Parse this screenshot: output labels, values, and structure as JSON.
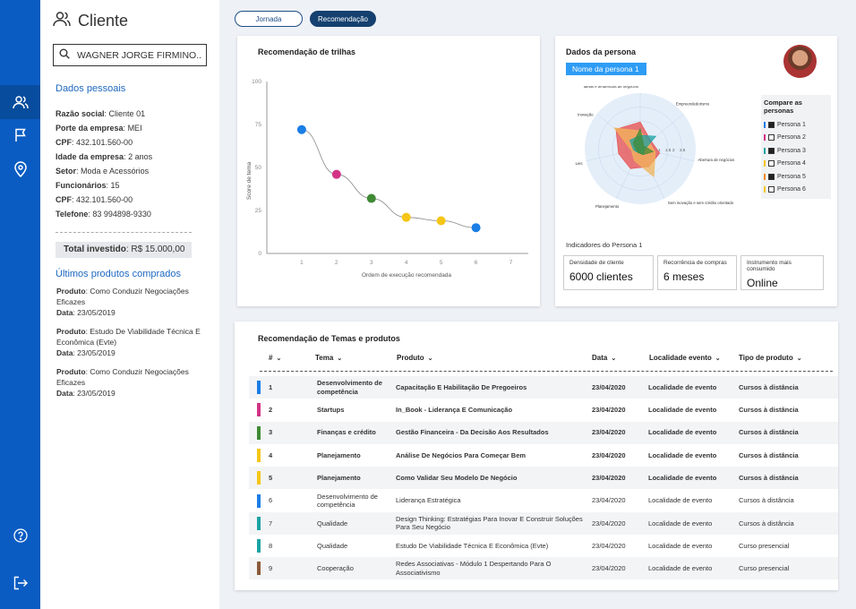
{
  "app": {
    "title": "Cliente"
  },
  "search": {
    "value": "WAGNER JORGE FIRMINO..."
  },
  "sidebar": {
    "section_title": "Dados pessoais"
  },
  "client_info": [
    {
      "label": "Razão social",
      "value": "Cliente 01"
    },
    {
      "label": "Porte da empresa",
      "value": "MEI"
    },
    {
      "label": "CPF",
      "value": "432.101.560-00"
    },
    {
      "label": "Idade da empresa",
      "value": "2 anos"
    },
    {
      "label": "Setor",
      "value": "Moda e Acessórios"
    },
    {
      "label": "Funcionários",
      "value": "15"
    },
    {
      "label": "CPF",
      "value": "432.101.560-00"
    },
    {
      "label": "Telefone",
      "value": "83 994898-9330"
    }
  ],
  "total": {
    "label": "Total investido",
    "value": "R$ 15.000,00"
  },
  "recent": {
    "title": "Últimos produtos comprados",
    "items": [
      {
        "produto_label": "Produto",
        "produto": "Como Conduzir Negociações Eficazes",
        "data_label": "Data",
        "data": "23/05/2019"
      },
      {
        "produto_label": "Produto",
        "produto": "Estudo De Viabilidade Técnica E Econômica (Evte)",
        "data_label": "Data",
        "data": "23/05/2019"
      },
      {
        "produto_label": "Produto",
        "produto": "Como Conduzir Negociações Eficazes",
        "data_label": "Data",
        "data": "23/05/2019"
      }
    ]
  },
  "tabs": [
    {
      "label": "Jornada"
    },
    {
      "label": "Recomendação"
    }
  ],
  "colors": {
    "rail": "#0a5cc2",
    "accent": "#1d68c1",
    "blue": "#1a7ee6",
    "magenta": "#d33486",
    "green": "#3f8a35",
    "yellow": "#f5c518",
    "teal": "#1ba3a3",
    "brown": "#8a5a3a",
    "orange": "#f28c28"
  },
  "chart_data": [
    {
      "type": "line",
      "title": "Recomendação de trilhas",
      "xlabel": "Ordem de execução recomendada",
      "ylabel": "Score de tema",
      "x": [
        1,
        2,
        3,
        4,
        5,
        6
      ],
      "y": [
        72,
        46,
        32,
        21,
        19,
        15
      ],
      "point_colors": [
        "#1a7ee6",
        "#d33486",
        "#3f8a35",
        "#f5c518",
        "#f5c518",
        "#1a7ee6"
      ],
      "xticks": [
        "1",
        "2",
        "3",
        "4",
        "5",
        "6",
        "7"
      ],
      "yticks": [
        "0",
        "25",
        "50",
        "75",
        "100"
      ],
      "xlim": [
        0,
        7.5
      ],
      "ylim": [
        0,
        100
      ]
    },
    {
      "type": "radar",
      "title": "Dados da persona",
      "axes": [
        "Ideias e tendências de negócios",
        "Empreendedorismo",
        "Abertura de negócios",
        "Sem inovação e sem crédito orientado",
        "Planejamento",
        "Leis",
        "Inovação"
      ],
      "ticks": [
        "1",
        "1.5",
        "2",
        "2.5"
      ],
      "series": [
        {
          "name": "Persona 1",
          "color": "#e84b4b",
          "values": [
            1.2,
            0.6,
            0.9,
            0.9,
            1.0,
            1.0,
            1.4
          ]
        },
        {
          "name": "Persona 4",
          "color": "#f2b45a",
          "values": [
            0.8,
            0.5,
            0.7,
            1.4,
            0.6,
            0.4,
            1.5
          ]
        },
        {
          "name": "Persona 3",
          "color": "#1ba3a3",
          "values": [
            0.6,
            0.9,
            0.2,
            0.3,
            0.2,
            0.3,
            0.6
          ]
        },
        {
          "name": "Persona 6",
          "color": "#3f8a35",
          "values": [
            0.9,
            0.2,
            0.6,
            0.3,
            0.2,
            0.2,
            0.4
          ]
        }
      ]
    }
  ],
  "persona": {
    "title": "Dados da persona",
    "name": "Nome da persona 1",
    "compare_title": "Compare as personas",
    "list": [
      {
        "label": "Persona 1",
        "color": "#1a7ee6",
        "checked": true
      },
      {
        "label": "Persona 2",
        "color": "#d33486",
        "checked": false
      },
      {
        "label": "Persona 3",
        "color": "#1ba3a3",
        "checked": true
      },
      {
        "label": "Persona 4",
        "color": "#f5c518",
        "checked": false
      },
      {
        "label": "Persona 5",
        "color": "#f28c28",
        "checked": true
      },
      {
        "label": "Persona 6",
        "color": "#f5c518",
        "checked": false
      }
    ],
    "indicators_title": "Indicadores do Persona 1",
    "indicators": [
      {
        "label": "Densidade de cliente",
        "value": "6000 clientes"
      },
      {
        "label": "Recorrência de compras",
        "value": "6 meses"
      },
      {
        "label": "Instrumento mais consumido",
        "value": "Online"
      }
    ]
  },
  "table": {
    "title": "Recomendação de Temas e produtos",
    "columns": [
      "#",
      "Tema",
      "Produto",
      "Data",
      "Localidade evento",
      "Tipo de produto"
    ],
    "rows": [
      {
        "n": "1",
        "tema": "Desenvolvimento de competência",
        "produto": "Capacitação E Habilitação De Pregoeiros",
        "data": "23/04/2020",
        "local": "Localidade de evento",
        "tipo": "Cursos à distância",
        "color": "#1a7ee6",
        "bold": true
      },
      {
        "n": "2",
        "tema": "Startups",
        "produto": "In_Book - Liderança E Comunicação",
        "data": "23/04/2020",
        "local": "Localidade de evento",
        "tipo": "Cursos à distância",
        "color": "#d33486",
        "bold": true
      },
      {
        "n": "3",
        "tema": "Finanças e crédito",
        "produto": "Gestão Financeira - Da Decisão Aos Resultados",
        "data": "23/04/2020",
        "local": "Localidade de evento",
        "tipo": "Cursos à distância",
        "color": "#3f8a35",
        "bold": true
      },
      {
        "n": "4",
        "tema": "Planejamento",
        "produto": "Análise De Negócios Para Começar Bem",
        "data": "23/04/2020",
        "local": "Localidade de evento",
        "tipo": "Cursos à distância",
        "color": "#f5c518",
        "bold": true
      },
      {
        "n": "5",
        "tema": "Planejamento",
        "produto": "Como Validar Seu Modelo De Negócio",
        "data": "23/04/2020",
        "local": "Localidade de evento",
        "tipo": "Cursos à distância",
        "color": "#f5c518",
        "bold": true
      },
      {
        "n": "6",
        "tema": "Desenvolvimento de competência",
        "produto": "Liderança Estratégica",
        "data": "23/04/2020",
        "local": "Localidade de evento",
        "tipo": "Cursos à distância",
        "color": "#1a7ee6",
        "bold": false
      },
      {
        "n": "7",
        "tema": "Qualidade",
        "produto": "Design Thinking: Estratégias Para Inovar E Construir Soluções Para Seu Negócio",
        "data": "23/04/2020",
        "local": "Localidade de evento",
        "tipo": "Cursos à distância",
        "color": "#1ba3a3",
        "bold": false
      },
      {
        "n": "8",
        "tema": "Qualidade",
        "produto": "Estudo De Viabilidade Técnica E Econômica (Evte)",
        "data": "23/04/2020",
        "local": "Localidade de evento",
        "tipo": "Curso presencial",
        "color": "#1ba3a3",
        "bold": false
      },
      {
        "n": "9",
        "tema": "Cooperação",
        "produto": "Redes Associativas - Módulo 1 Despertando Para O Associativismo",
        "data": "23/04/2020",
        "local": "Localidade de evento",
        "tipo": "Curso presencial",
        "color": "#8a5a3a",
        "bold": false
      }
    ]
  }
}
